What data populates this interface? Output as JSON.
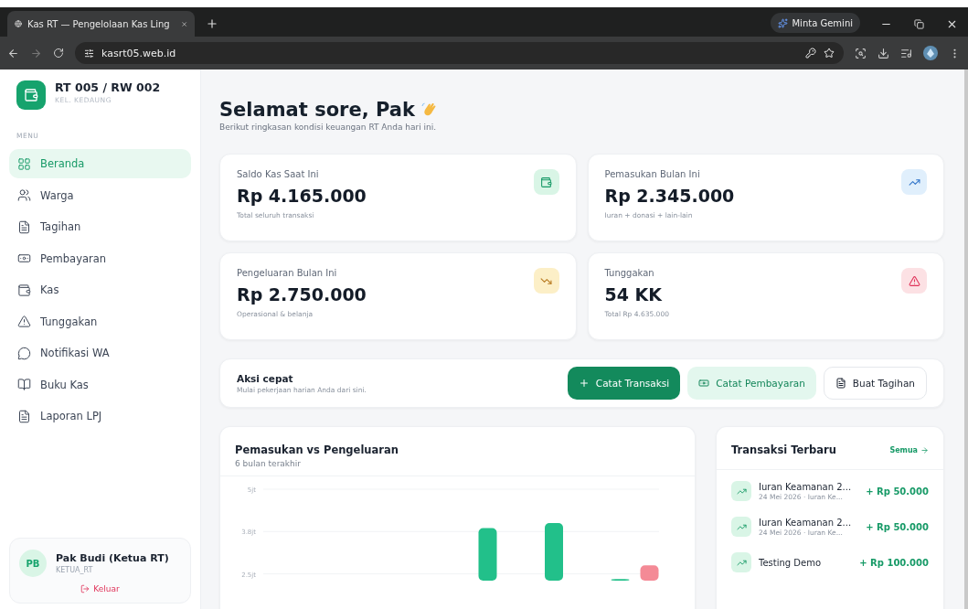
{
  "browser": {
    "tab_title": "Kas RT — Pengelolaan Kas Ling",
    "url": "kasrt05.web.id",
    "gemini_button": "Minta Gemini"
  },
  "sidebar": {
    "org_name": "RT 005 / RW 002",
    "org_sub": "KEL. KEDAUNG",
    "menu_label": "MENU",
    "items": [
      {
        "label": "Beranda",
        "selected": true
      },
      {
        "label": "Warga",
        "selected": false
      },
      {
        "label": "Tagihan",
        "selected": false
      },
      {
        "label": "Pembayaran",
        "selected": false
      },
      {
        "label": "Kas",
        "selected": false
      },
      {
        "label": "Tunggakan",
        "selected": false
      },
      {
        "label": "Notifikasi WA",
        "selected": false
      },
      {
        "label": "Buku Kas",
        "selected": false
      },
      {
        "label": "Laporan LPJ",
        "selected": false
      }
    ],
    "user": {
      "initials": "PB",
      "name": "Pak Budi (Ketua RT)",
      "role": "KETUA_RT",
      "logout": "Keluar"
    }
  },
  "greeting": {
    "title": "Selamat sore, Pak",
    "subtitle": "Berikut ringkasan kondisi keuangan RT Anda hari ini."
  },
  "stats": [
    {
      "label": "Saldo Kas Saat Ini",
      "value": "Rp 4.165.000",
      "note": "Total seluruh transaksi",
      "color": "#d9f5e6"
    },
    {
      "label": "Pemasukan Bulan Ini",
      "value": "Rp 2.345.000",
      "note": "Iuran + donasi + lain-lain",
      "color": "#e0effc"
    },
    {
      "label": "Pengeluaran Bulan Ini",
      "value": "Rp 2.750.000",
      "note": "Operasional & belanja",
      "color": "#fcefc7"
    },
    {
      "label": "Tunggakan",
      "value": "54 KK",
      "note": "Total Rp 4.635.000",
      "color": "#fce1e4"
    }
  ],
  "quick_actions": {
    "title": "Aksi cepat",
    "subtitle": "Mulai pekerjaan harian Anda dari sini.",
    "buttons": [
      {
        "label": "Catat Transaksi",
        "kind": "primary"
      },
      {
        "label": "Catat Pembayaran",
        "kind": "soft"
      },
      {
        "label": "Buat Tagihan",
        "kind": "outline"
      }
    ]
  },
  "chart_card": {
    "title": "Pemasukan vs Pengeluaran",
    "subtitle": "6 bulan terakhir",
    "chart_data": {
      "type": "bar",
      "ylim": [
        2.3,
        5
      ],
      "yticks": [
        {
          "value": 5,
          "label": "5jt"
        },
        {
          "value": 3.75,
          "label": "3.8jt"
        },
        {
          "value": 2.5,
          "label": "2.5jt"
        }
      ],
      "series": [
        {
          "color": "#22c08a",
          "values": [
            null,
            null,
            null,
            3.85,
            4.0,
            2.35
          ]
        },
        {
          "color": "#f48a96",
          "values": [
            null,
            null,
            null,
            null,
            null,
            2.75
          ]
        }
      ]
    }
  },
  "transactions": {
    "title": "Transaksi Terbaru",
    "link": "Semua",
    "items": [
      {
        "title": "Iuran Keamanan 2...",
        "meta": "24 Mei 2026 · Iuran Ke...",
        "amount": "+ Rp 50.000"
      },
      {
        "title": "Iuran Keamanan 2...",
        "meta": "24 Mei 2026 · Iuran Ke...",
        "amount": "+ Rp 50.000"
      },
      {
        "title": "Testing Demo",
        "amount": "+ Rp 100.000"
      }
    ]
  }
}
